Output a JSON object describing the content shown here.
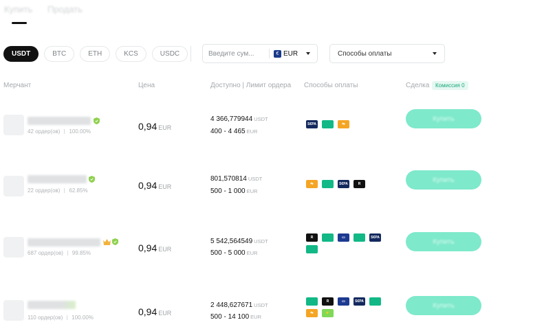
{
  "tabs": {
    "buy": "Купить",
    "sell": "Продать"
  },
  "coins": [
    "USDT",
    "BTC",
    "ETH",
    "KCS",
    "USDC"
  ],
  "amount": {
    "placeholder": "Введите сум...",
    "currency_symbol": "€",
    "currency": "EUR"
  },
  "payment_filter": {
    "label": "Способы оплаты"
  },
  "table_headers": {
    "merchant": "Мерчант",
    "price": "Цена",
    "available": "Доступно | Лимит ордера",
    "methods": "Способы оплаты",
    "deal": "Сделка",
    "fee": "Комиссия 0"
  },
  "rows": [
    {
      "orders": "42 ордер(ов)",
      "completion": "100.00%",
      "price": "0,94",
      "price_unit": "EUR",
      "available": "4 366,779944",
      "available_unit": "USDT",
      "limit": "400 - 4 465",
      "limit_unit": "EUR",
      "methods": [
        "sepa-icon",
        "card-icon",
        "transfer-icon"
      ],
      "button": "Купить"
    },
    {
      "orders": "22 ордер(ов)",
      "completion": "62.85%",
      "price": "0,94",
      "price_unit": "EUR",
      "available": "801,570814",
      "available_unit": "USDT",
      "limit": "500 - 1 000",
      "limit_unit": "EUR",
      "methods": [
        "transfer-icon",
        "card-icon",
        "sepa-icon",
        "revolut-icon"
      ],
      "button": "Купить"
    },
    {
      "orders": "687 ордер(ов)",
      "completion": "99.85%",
      "price": "0,94",
      "price_unit": "EUR",
      "available": "5 542,564549",
      "available_unit": "USDT",
      "limit": "500 - 5 000",
      "limit_unit": "EUR",
      "methods": [
        "revolut-icon",
        "card-icon",
        "bank-icon",
        "card-icon",
        "sepa-icon",
        "card-icon"
      ],
      "button": "Купить"
    },
    {
      "orders": "110 ордер(ов)",
      "completion": "100.00%",
      "price": "0,94",
      "price_unit": "EUR",
      "available": "2 448,627671",
      "available_unit": "USDT",
      "limit": "500 - 14 100",
      "limit_unit": "EUR",
      "methods": [
        "card-icon",
        "revolut-icon",
        "bank-icon",
        "sepa-icon",
        "card-icon",
        "transfer-icon",
        "green-pay-icon"
      ],
      "button": "Купить"
    }
  ],
  "colors": {
    "accent": "#7ee9cb",
    "verified": "#8fd14f",
    "crown": "#f2b33d",
    "fee_badge_bg": "#e5f8f1"
  }
}
